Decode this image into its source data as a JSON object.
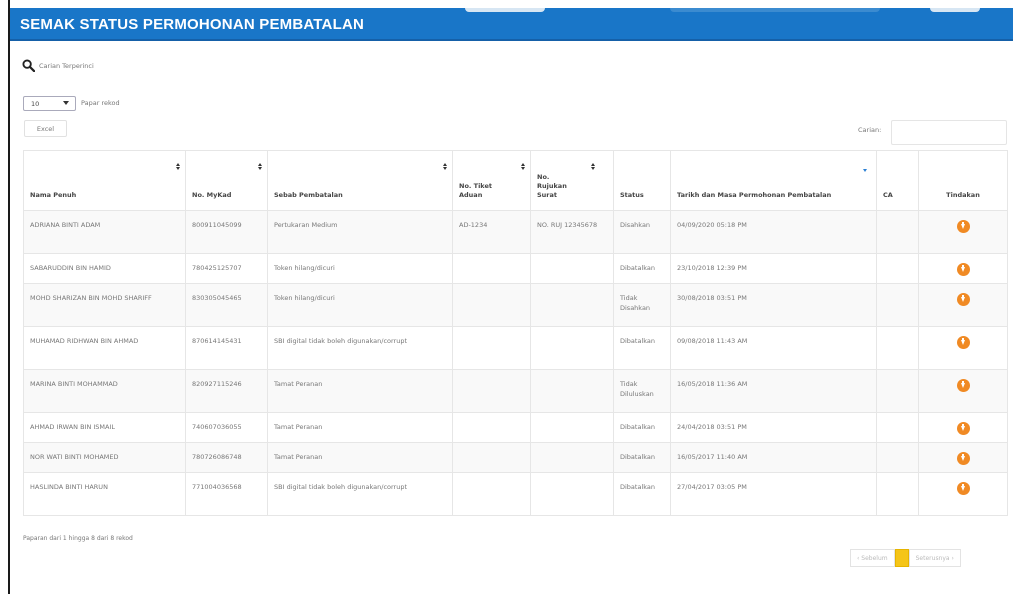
{
  "page_title": "SEMAK STATUS PERMOHONAN PEMBATALAN",
  "advanced_search": {
    "icon": "search-icon",
    "label": "Carian Terperinci"
  },
  "length_menu": {
    "value": "10",
    "label": "Papar rekod"
  },
  "excel_button": "Excel",
  "search": {
    "label": "Carian:",
    "value": ""
  },
  "table": {
    "headers": [
      "Nama Penuh",
      "No. MyKad",
      "Sebab Pembatalan",
      "No. Tiket Aduan",
      "No. Rujukan Surat",
      "Status",
      "Tarikh dan Masa Permohonan Pembatalan",
      "CA",
      "Tindakan"
    ],
    "rows": [
      [
        "ADRIANA BINTI ADAM",
        "800911045099",
        "Pertukaran Medium",
        "AD-1234",
        "NO. RUJ 12345678",
        "Disahkan",
        "04/09/2020 05:18 PM",
        ""
      ],
      [
        "SABARUDDIN BIN HAMID",
        "780425125707",
        "Token hilang/dicuri",
        "",
        "",
        "Dibatalkan",
        "23/10/2018 12:39 PM",
        ""
      ],
      [
        "MOHD SHARIZAN BIN MOHD SHARIFF",
        "830305045465",
        "Token hilang/dicuri",
        "",
        "",
        "Tidak Disahkan",
        "30/08/2018 03:51 PM",
        ""
      ],
      [
        "MUHAMAD RIDHWAN BIN AHMAD",
        "870614145431",
        "SBI digital tidak boleh digunakan/corrupt",
        "",
        "",
        "Dibatalkan",
        "09/08/2018 11:43 AM",
        ""
      ],
      [
        "MARINA BINTI MOHAMMAD",
        "820927115246",
        "Tamat Peranan",
        "",
        "",
        "Tidak Diluluskan",
        "16/05/2018 11:36 AM",
        ""
      ],
      [
        "AHMAD IRWAN BIN ISMAIL",
        "740607036055",
        "Tamat Peranan",
        "",
        "",
        "Dibatalkan",
        "24/04/2018 03:51 PM",
        ""
      ],
      [
        "NOR WATI BINTI MOHAMED",
        "780726086748",
        "Tamat Peranan",
        "",
        "",
        "Dibatalkan",
        "16/05/2017 11:40 AM",
        ""
      ],
      [
        "HASLINDA BINTI HARUN",
        "771004036568",
        "SBI digital tidak boleh digunakan/corrupt",
        "",
        "",
        "Dibatalkan",
        "27/04/2017 03:05 PM",
        ""
      ]
    ],
    "action_icon": "download-icon",
    "action_color": "#f08a24"
  },
  "info": "Paparan dari 1 hingga 8 dari 8 rekod",
  "pagination": {
    "prev": "‹ Sebelum",
    "current": "1",
    "next": "Seterusnya ›"
  },
  "colors": {
    "header_bar": "#1976c8",
    "pager_active": "#f5c518"
  }
}
